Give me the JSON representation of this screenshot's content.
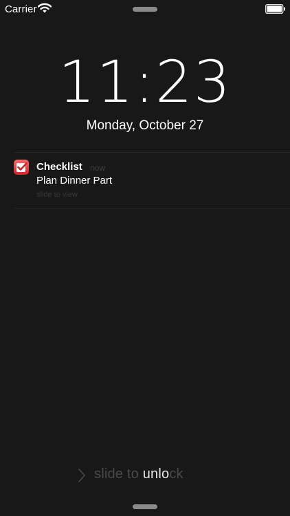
{
  "status_bar": {
    "carrier": "Carrier"
  },
  "lock_screen": {
    "time_hours": "11",
    "time_separator": ":",
    "time_minutes": "23",
    "date": "Monday, October 27"
  },
  "notification": {
    "app_name": "Checklist",
    "time_ago": "now",
    "message": "Plan Dinner Part",
    "action_hint": "slide to view"
  },
  "unlock": {
    "text_dim": "slide to ",
    "text_highlight": "unlo",
    "text_dim_end": "ck"
  },
  "icons": {
    "wifi": "wifi-icon",
    "battery": "battery-icon",
    "app": "checklist-app-icon",
    "chevron": "chevron-right-icon"
  },
  "colors": {
    "background": "#181818",
    "app_icon": "#e0383d",
    "grabber": "#8a8a8a"
  }
}
